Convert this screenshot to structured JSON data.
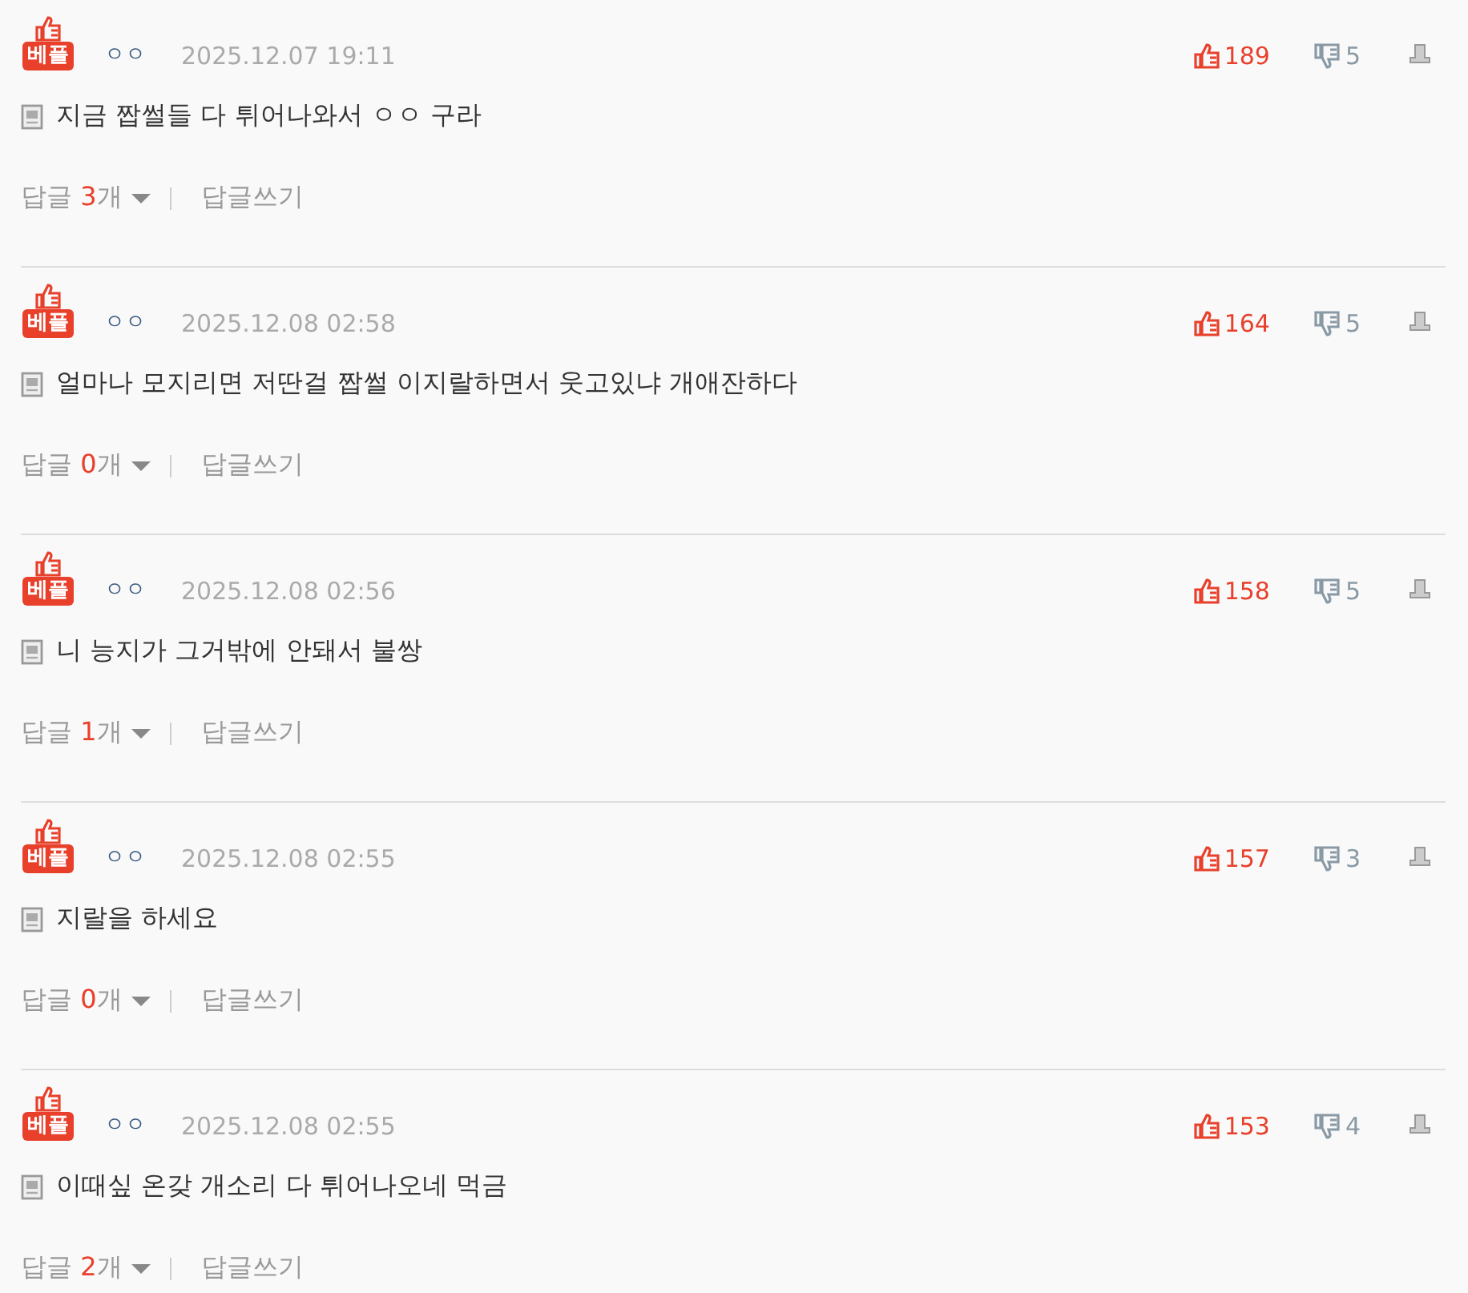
{
  "comments": [
    {
      "badge": "베플",
      "author": "ㅇㅇ",
      "date": "2025.12.07 19:11",
      "likes": "189",
      "dislikes": "5",
      "text": "지금 짭썰들 다 튀어나와서 ㅇㅇ 구라",
      "reply_prefix": "답글",
      "reply_count": "3",
      "reply_suffix": "개",
      "write_reply": "답글쓰기"
    },
    {
      "badge": "베플",
      "author": "ㅇㅇ",
      "date": "2025.12.08 02:58",
      "likes": "164",
      "dislikes": "5",
      "text": "얼마나 모지리면 저딴걸 짭썰 이지랄하면서 웃고있냐 개애잔하다",
      "reply_prefix": "답글",
      "reply_count": "0",
      "reply_suffix": "개",
      "write_reply": "답글쓰기"
    },
    {
      "badge": "베플",
      "author": "ㅇㅇ",
      "date": "2025.12.08 02:56",
      "likes": "158",
      "dislikes": "5",
      "text": "니 능지가 그거밖에 안돼서 불쌍",
      "reply_prefix": "답글",
      "reply_count": "1",
      "reply_suffix": "개",
      "write_reply": "답글쓰기"
    },
    {
      "badge": "베플",
      "author": "ㅇㅇ",
      "date": "2025.12.08 02:55",
      "likes": "157",
      "dislikes": "3",
      "text": "지랄을 하세요",
      "reply_prefix": "답글",
      "reply_count": "0",
      "reply_suffix": "개",
      "write_reply": "답글쓰기"
    },
    {
      "badge": "베플",
      "author": "ㅇㅇ",
      "date": "2025.12.08 02:55",
      "likes": "153",
      "dislikes": "4",
      "text": "이때싶 온갖 개소리 다 튀어나오네 먹금",
      "reply_prefix": "답글",
      "reply_count": "2",
      "reply_suffix": "개",
      "write_reply": "답글쓰기"
    }
  ]
}
